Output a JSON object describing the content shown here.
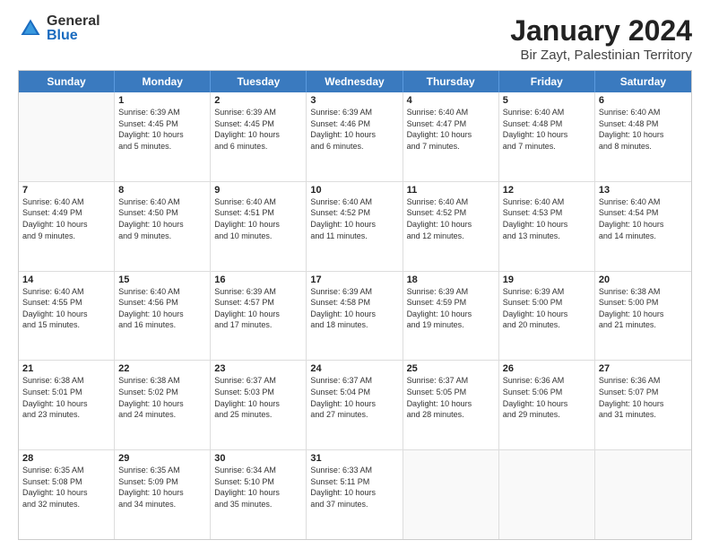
{
  "logo": {
    "general": "General",
    "blue": "Blue"
  },
  "header": {
    "title": "January 2024",
    "subtitle": "Bir Zayt, Palestinian Territory"
  },
  "calendar": {
    "days": [
      "Sunday",
      "Monday",
      "Tuesday",
      "Wednesday",
      "Thursday",
      "Friday",
      "Saturday"
    ],
    "rows": [
      [
        {
          "day": "",
          "info": ""
        },
        {
          "day": "1",
          "info": "Sunrise: 6:39 AM\nSunset: 4:45 PM\nDaylight: 10 hours\nand 5 minutes."
        },
        {
          "day": "2",
          "info": "Sunrise: 6:39 AM\nSunset: 4:45 PM\nDaylight: 10 hours\nand 6 minutes."
        },
        {
          "day": "3",
          "info": "Sunrise: 6:39 AM\nSunset: 4:46 PM\nDaylight: 10 hours\nand 6 minutes."
        },
        {
          "day": "4",
          "info": "Sunrise: 6:40 AM\nSunset: 4:47 PM\nDaylight: 10 hours\nand 7 minutes."
        },
        {
          "day": "5",
          "info": "Sunrise: 6:40 AM\nSunset: 4:48 PM\nDaylight: 10 hours\nand 7 minutes."
        },
        {
          "day": "6",
          "info": "Sunrise: 6:40 AM\nSunset: 4:48 PM\nDaylight: 10 hours\nand 8 minutes."
        }
      ],
      [
        {
          "day": "7",
          "info": "Sunrise: 6:40 AM\nSunset: 4:49 PM\nDaylight: 10 hours\nand 9 minutes."
        },
        {
          "day": "8",
          "info": "Sunrise: 6:40 AM\nSunset: 4:50 PM\nDaylight: 10 hours\nand 9 minutes."
        },
        {
          "day": "9",
          "info": "Sunrise: 6:40 AM\nSunset: 4:51 PM\nDaylight: 10 hours\nand 10 minutes."
        },
        {
          "day": "10",
          "info": "Sunrise: 6:40 AM\nSunset: 4:52 PM\nDaylight: 10 hours\nand 11 minutes."
        },
        {
          "day": "11",
          "info": "Sunrise: 6:40 AM\nSunset: 4:52 PM\nDaylight: 10 hours\nand 12 minutes."
        },
        {
          "day": "12",
          "info": "Sunrise: 6:40 AM\nSunset: 4:53 PM\nDaylight: 10 hours\nand 13 minutes."
        },
        {
          "day": "13",
          "info": "Sunrise: 6:40 AM\nSunset: 4:54 PM\nDaylight: 10 hours\nand 14 minutes."
        }
      ],
      [
        {
          "day": "14",
          "info": "Sunrise: 6:40 AM\nSunset: 4:55 PM\nDaylight: 10 hours\nand 15 minutes."
        },
        {
          "day": "15",
          "info": "Sunrise: 6:40 AM\nSunset: 4:56 PM\nDaylight: 10 hours\nand 16 minutes."
        },
        {
          "day": "16",
          "info": "Sunrise: 6:39 AM\nSunset: 4:57 PM\nDaylight: 10 hours\nand 17 minutes."
        },
        {
          "day": "17",
          "info": "Sunrise: 6:39 AM\nSunset: 4:58 PM\nDaylight: 10 hours\nand 18 minutes."
        },
        {
          "day": "18",
          "info": "Sunrise: 6:39 AM\nSunset: 4:59 PM\nDaylight: 10 hours\nand 19 minutes."
        },
        {
          "day": "19",
          "info": "Sunrise: 6:39 AM\nSunset: 5:00 PM\nDaylight: 10 hours\nand 20 minutes."
        },
        {
          "day": "20",
          "info": "Sunrise: 6:38 AM\nSunset: 5:00 PM\nDaylight: 10 hours\nand 21 minutes."
        }
      ],
      [
        {
          "day": "21",
          "info": "Sunrise: 6:38 AM\nSunset: 5:01 PM\nDaylight: 10 hours\nand 23 minutes."
        },
        {
          "day": "22",
          "info": "Sunrise: 6:38 AM\nSunset: 5:02 PM\nDaylight: 10 hours\nand 24 minutes."
        },
        {
          "day": "23",
          "info": "Sunrise: 6:37 AM\nSunset: 5:03 PM\nDaylight: 10 hours\nand 25 minutes."
        },
        {
          "day": "24",
          "info": "Sunrise: 6:37 AM\nSunset: 5:04 PM\nDaylight: 10 hours\nand 27 minutes."
        },
        {
          "day": "25",
          "info": "Sunrise: 6:37 AM\nSunset: 5:05 PM\nDaylight: 10 hours\nand 28 minutes."
        },
        {
          "day": "26",
          "info": "Sunrise: 6:36 AM\nSunset: 5:06 PM\nDaylight: 10 hours\nand 29 minutes."
        },
        {
          "day": "27",
          "info": "Sunrise: 6:36 AM\nSunset: 5:07 PM\nDaylight: 10 hours\nand 31 minutes."
        }
      ],
      [
        {
          "day": "28",
          "info": "Sunrise: 6:35 AM\nSunset: 5:08 PM\nDaylight: 10 hours\nand 32 minutes."
        },
        {
          "day": "29",
          "info": "Sunrise: 6:35 AM\nSunset: 5:09 PM\nDaylight: 10 hours\nand 34 minutes."
        },
        {
          "day": "30",
          "info": "Sunrise: 6:34 AM\nSunset: 5:10 PM\nDaylight: 10 hours\nand 35 minutes."
        },
        {
          "day": "31",
          "info": "Sunrise: 6:33 AM\nSunset: 5:11 PM\nDaylight: 10 hours\nand 37 minutes."
        },
        {
          "day": "",
          "info": ""
        },
        {
          "day": "",
          "info": ""
        },
        {
          "day": "",
          "info": ""
        }
      ]
    ]
  }
}
